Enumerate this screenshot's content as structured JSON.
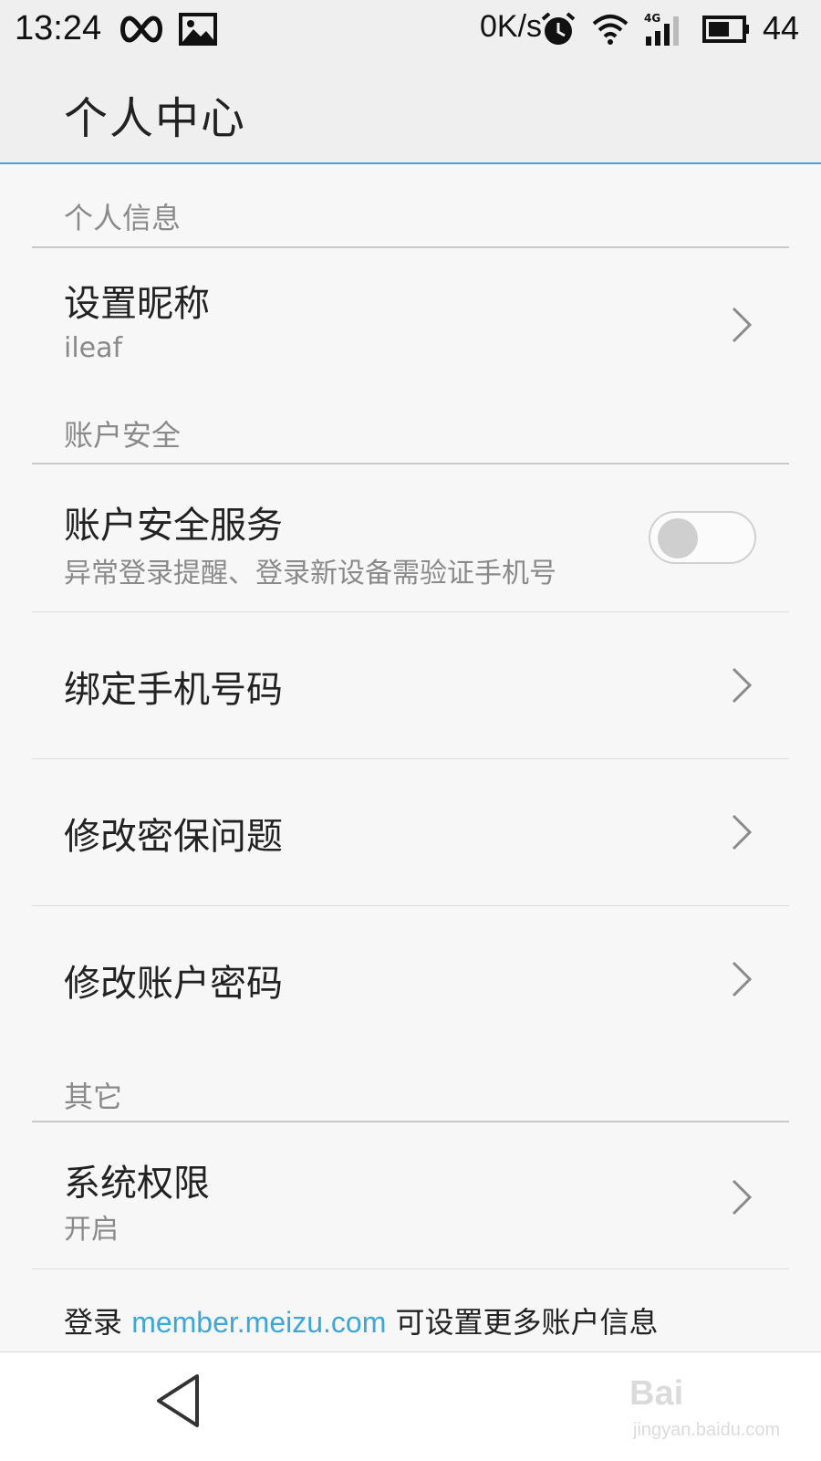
{
  "status_bar": {
    "time": "13:24",
    "net_speed": "0K/s",
    "battery_level": "44",
    "icons": [
      "infinity-icon",
      "image-icon",
      "alarm-icon",
      "wifi-icon",
      "signal-4g-icon",
      "battery-icon"
    ]
  },
  "header": {
    "title": "个人中心"
  },
  "sections": {
    "personal_info": {
      "label": "个人信息",
      "nickname": {
        "title": "设置昵称",
        "value": "ileaf"
      }
    },
    "account_security": {
      "label": "账户安全",
      "security_service": {
        "title": "账户安全服务",
        "subtitle": "异常登录提醒、登录新设备需验证手机号",
        "enabled": false
      },
      "bind_phone": {
        "title": "绑定手机号码"
      },
      "security_question": {
        "title": "修改密保问题"
      },
      "change_password": {
        "title": "修改账户密码"
      }
    },
    "other": {
      "label": "其它",
      "system_permission": {
        "title": "系统权限",
        "value": "开启"
      }
    }
  },
  "footer": {
    "prefix": "登录 ",
    "link": "member.meizu.com",
    "suffix": " 可设置更多账户信息"
  },
  "watermark": {
    "text": "Bai",
    "sub": "jingyan.baidu.com"
  },
  "colors": {
    "accent": "#4aa3d6",
    "link": "#3fa6d8",
    "background": "#f7f7f7"
  }
}
